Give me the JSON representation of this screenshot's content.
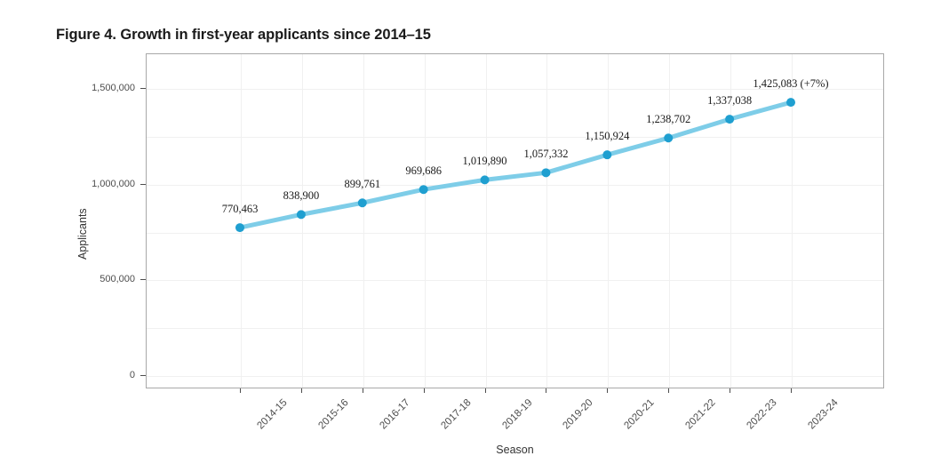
{
  "figure": {
    "title": "Figure 4. Growth in first-year applicants since 2014–15"
  },
  "axes": {
    "x_title": "Season",
    "y_title": "Applicants",
    "y_tick_labels": [
      "0",
      "500,000",
      "1,000,000",
      "1,500,000"
    ]
  },
  "style": {
    "line_color": "#7ecde8",
    "marker_color": "#1f9fd0",
    "grid_color": "#f0f0f0",
    "frame_color": "#a8a8a8",
    "tick_text_color": "#4d4d4d",
    "title_color": "#1a1a1a"
  },
  "chart_data": {
    "type": "line",
    "title": "Figure 4. Growth in first-year applicants since 2014–15",
    "xlabel": "Season",
    "ylabel": "Applicants",
    "categories": [
      "2014-15",
      "2015-16",
      "2016-17",
      "2017-18",
      "2018-19",
      "2019-20",
      "2020-21",
      "2021-22",
      "2022-23",
      "2023-24"
    ],
    "values": [
      770463,
      838900,
      899761,
      969686,
      1019890,
      1057332,
      1150924,
      1238702,
      1337038,
      1425083
    ],
    "point_labels": [
      "770,463",
      "838,900",
      "899,761",
      "969,686",
      "1,019,890",
      "1,057,332",
      "1,150,924",
      "1,238,702",
      "1,337,038",
      "1,425,083 (+7%)"
    ],
    "series": [
      {
        "name": "First-year applicants",
        "values": [
          770463,
          838900,
          899761,
          969686,
          1019890,
          1057332,
          1150924,
          1238702,
          1337038,
          1425083
        ]
      }
    ],
    "ylim": [
      0,
      1600000
    ],
    "yticks": [
      0,
      500000,
      1000000,
      1500000
    ],
    "ytick_labels": [
      "0",
      "500,000",
      "1,000,000",
      "1,500,000"
    ],
    "minor_gridline_step": 250000,
    "grid": true,
    "legend": false,
    "annotations": [
      "1,425,083 (+7%)"
    ]
  }
}
